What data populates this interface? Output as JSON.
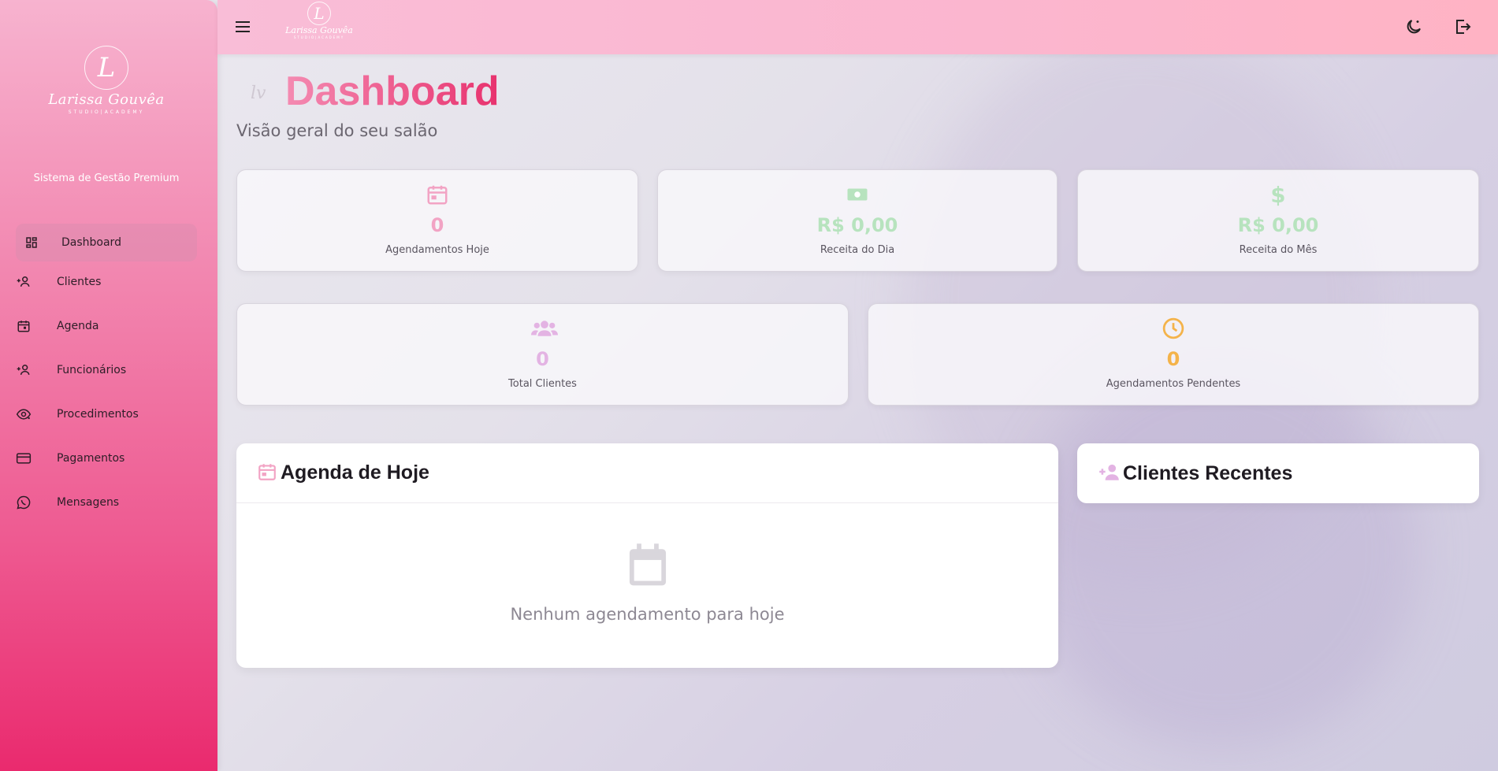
{
  "brand": {
    "monogram": "L",
    "name": "Larissa Gouvêa",
    "tagline": "STUDIO|ACADEMY",
    "system_subtitle": "Sistema de Gestão Premium"
  },
  "sidebar": {
    "items": [
      {
        "label": "Dashboard",
        "icon": "dashboard-icon",
        "active": true
      },
      {
        "label": "Clientes",
        "icon": "person-add-icon"
      },
      {
        "label": "Agenda",
        "icon": "calendar-icon"
      },
      {
        "label": "Funcionários",
        "icon": "person-add-icon"
      },
      {
        "label": "Procedimentos",
        "icon": "eye-sparkle-icon"
      },
      {
        "label": "Pagamentos",
        "icon": "credit-card-icon"
      },
      {
        "label": "Mensagens",
        "icon": "whatsapp-icon"
      }
    ]
  },
  "topbar": {
    "menu_icon": "hamburger-icon",
    "theme_icon": "moon-icon",
    "logout_icon": "logout-icon"
  },
  "page": {
    "title": "Dashboard",
    "subtitle": "Visão geral do seu salão"
  },
  "stats": [
    {
      "value": "0",
      "label": "Agendamentos Hoje",
      "icon": "calendar-icon",
      "color": "#f2a3c4"
    },
    {
      "value": "R$ 0,00",
      "label": "Receita do Dia",
      "icon": "cash-icon",
      "color": "#b7e3be"
    },
    {
      "value": "R$ 0,00",
      "label": "Receita do Mês",
      "icon": "dollar-icon",
      "color": "#b7e3be"
    },
    {
      "value": "0",
      "label": "Total Clientes",
      "icon": "group-icon",
      "color": "#e3b3e3"
    },
    {
      "value": "0",
      "label": "Agendamentos Pendentes",
      "icon": "clock-icon",
      "color": "#f4b34a"
    }
  ],
  "agenda_panel": {
    "title": "Agenda de Hoje",
    "empty_message": "Nenhum agendamento para hoje"
  },
  "recent_clients_panel": {
    "title": "Clientes Recentes"
  },
  "colors": {
    "accent": "#e8326e",
    "sidebar_top": "#f7b3cf",
    "sidebar_bottom": "#ea2a6e"
  }
}
